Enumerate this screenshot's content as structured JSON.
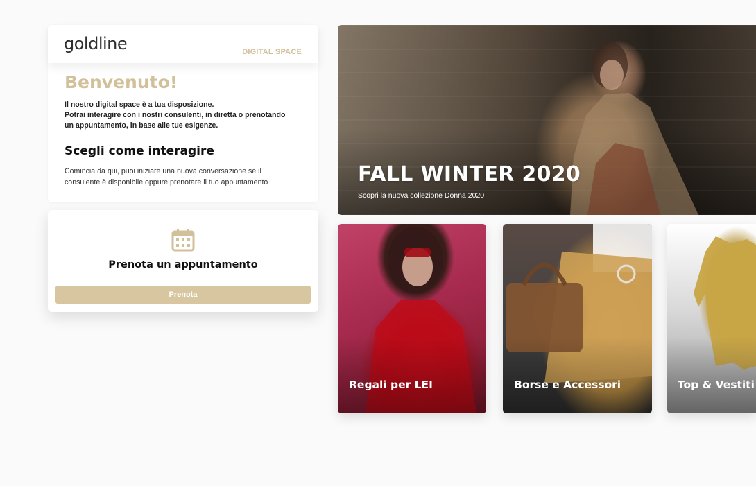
{
  "brand": {
    "logo_text": "goldline",
    "section_label": "DIGITAL SPACE",
    "accent_color": "#d2c09a"
  },
  "welcome": {
    "title": "Benvenuto!",
    "lines": [
      "Il nostro digital space è a tua disposizione.",
      "Potrai interagire con i nostri consulenti, in diretta o prenotando",
      "un appuntamento, in base alle tue esigenze."
    ],
    "interact_title": "Scegli come interagire",
    "interact_lines": [
      "Comincia da qui, puoi iniziare una nuova conversazione se il",
      "consulente è disponibile oppure prenotare il tuo appuntamento"
    ]
  },
  "booking": {
    "icon": "calendar-icon",
    "title": "Prenota un appuntamento",
    "button_label": "Prenota",
    "button_color": "#d8c6a1"
  },
  "hero": {
    "title": "FALL WINTER 2020",
    "subtitle": "Scopri la nuova collezione Donna 2020"
  },
  "categories": [
    {
      "label": "Regali per LEI"
    },
    {
      "label": "Borse e Accessori"
    },
    {
      "label": "Top & Vestiti"
    }
  ]
}
